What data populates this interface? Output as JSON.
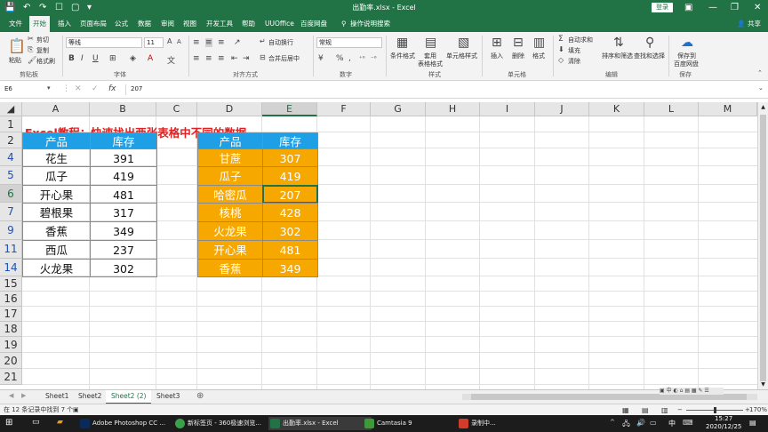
{
  "titlebar": {
    "title": "出勤率.xlsx - Excel",
    "login": "登录",
    "undo_icon": "undo-icon",
    "redo_icon": "redo-icon",
    "minimize": "—",
    "restore": "❐",
    "close": "✕",
    "ribbon_display": "▣"
  },
  "tabs": [
    "文件",
    "开始",
    "插入",
    "页面布局",
    "公式",
    "数据",
    "审阅",
    "视图",
    "开发工具",
    "帮助",
    "UUOffice",
    "百度网盘",
    "操作说明搜索"
  ],
  "share": "共享",
  "ribbon": {
    "paste": "粘贴",
    "cut": "剪切",
    "copy": "复制",
    "format_painter": "格式刷",
    "clipboard": "剪贴板",
    "font_name": "等线",
    "font_size": "11",
    "font_group": "字体",
    "bold": "B",
    "italic": "I",
    "underline": "U",
    "wrap_text": "自动换行",
    "merge_center": "合并后居中",
    "align_group": "对齐方式",
    "number_format": "常规",
    "percent": "%",
    "comma": ",",
    "number_group": "数字",
    "conditional_format": "条件格式",
    "table_format": "套用\n表格格式",
    "cell_styles": "单元格样式",
    "styles_group": "样式",
    "insert": "插入",
    "delete": "删除",
    "format": "格式",
    "cells_group": "单元格",
    "autosum": "自动求和",
    "fill": "填充",
    "clear": "清除",
    "sort_filter": "排序和筛选",
    "find_select": "查找和选择",
    "editing_group": "编辑",
    "save_baidu": "保存到\n百度网盘",
    "save_group": "保存"
  },
  "formula_bar": {
    "name_box": "E6",
    "fx": "fx",
    "value": "207"
  },
  "columns": [
    "A",
    "B",
    "C",
    "D",
    "E",
    "F",
    "G",
    "H",
    "I",
    "J",
    "K",
    "L",
    "M"
  ],
  "rows": [
    "1",
    "2",
    "4",
    "5",
    "6",
    "7",
    "9",
    "11",
    "14",
    "15",
    "16",
    "17",
    "18",
    "19",
    "20",
    "21"
  ],
  "heading": "Excel教程：快速找出两张表格中不同的数据",
  "table_a": {
    "headers": [
      "产品",
      "库存"
    ],
    "rows": [
      [
        "花生",
        "391"
      ],
      [
        "瓜子",
        "419"
      ],
      [
        "开心果",
        "481"
      ],
      [
        "碧根果",
        "317"
      ],
      [
        "香蕉",
        "349"
      ],
      [
        "西瓜",
        "237"
      ],
      [
        "火龙果",
        "302"
      ]
    ]
  },
  "table_d": {
    "headers": [
      "产品",
      "库存"
    ],
    "rows": [
      [
        "甘蔗",
        "307"
      ],
      [
        "瓜子",
        "419"
      ],
      [
        "哈密瓜",
        "207"
      ],
      [
        "核桃",
        "428"
      ],
      [
        "火龙果",
        "302"
      ],
      [
        "开心果",
        "481"
      ],
      [
        "香蕉",
        "349"
      ]
    ]
  },
  "sheets": [
    "Sheet1",
    "Sheet2",
    "Sheet2 (2)",
    "Sheet3"
  ],
  "active_sheet": "Sheet2 (2)",
  "add_sheet": "⊕",
  "status": {
    "left": "在 12 条记录中找到 7 个",
    "zoom": "170%"
  },
  "taskbar": {
    "apps": [
      "Adobe Photoshop CC ...",
      "新标签页 - 360极速浏览...",
      "出勤率.xlsx - Excel",
      "Camtasia 9",
      "录制中..."
    ],
    "time": "15:27",
    "date": "2020/12/25",
    "ime": "中"
  },
  "colors": {
    "excel_green": "#217346",
    "header_blue": "#1fa0e6",
    "cell_orange": "#f7a800",
    "heading_red": "#e02020"
  }
}
